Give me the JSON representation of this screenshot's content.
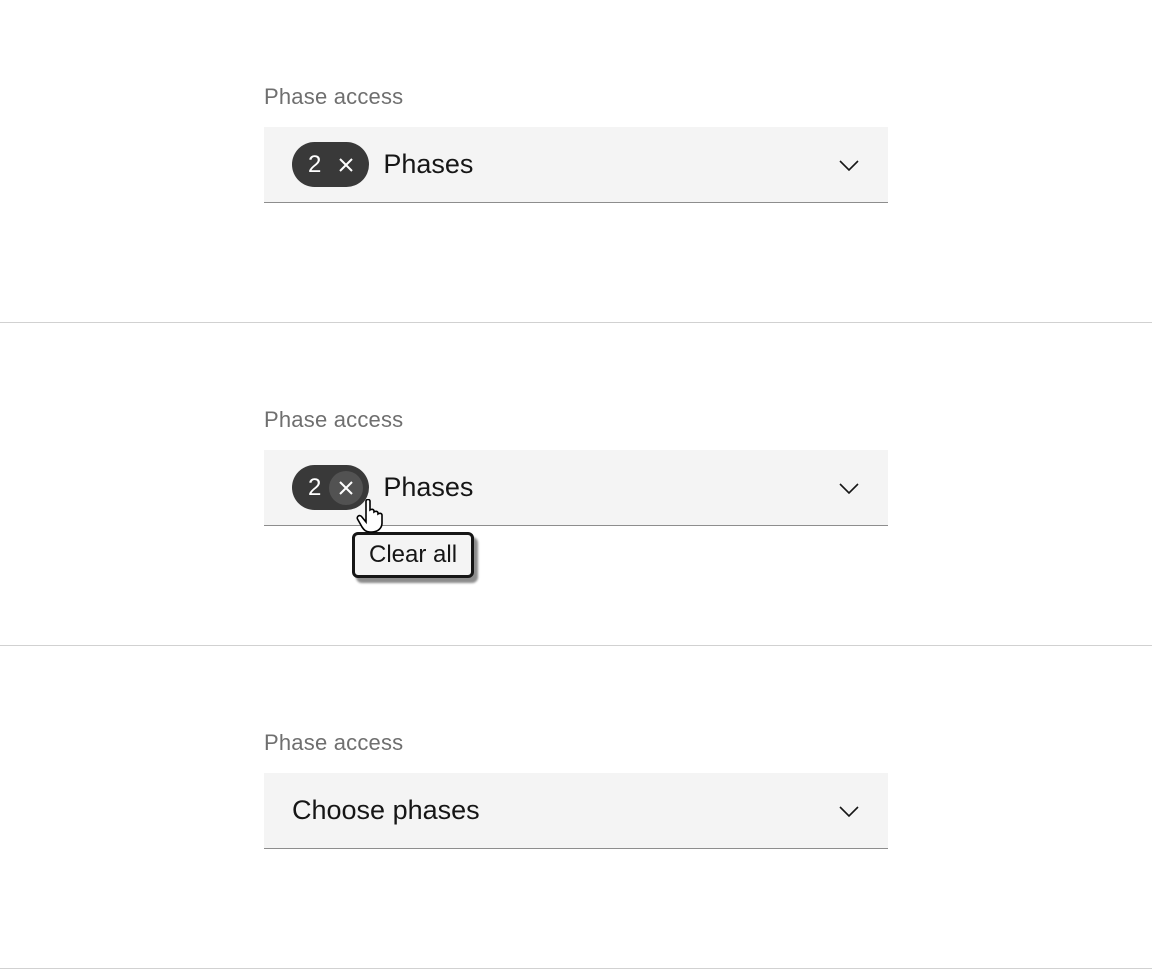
{
  "section1": {
    "label": "Phase access",
    "count": "2",
    "text": "Phases"
  },
  "section2": {
    "label": "Phase access",
    "count": "2",
    "text": "Phases",
    "tooltip": "Clear all"
  },
  "section3": {
    "label": "Phase access",
    "placeholder": "Choose phases"
  }
}
